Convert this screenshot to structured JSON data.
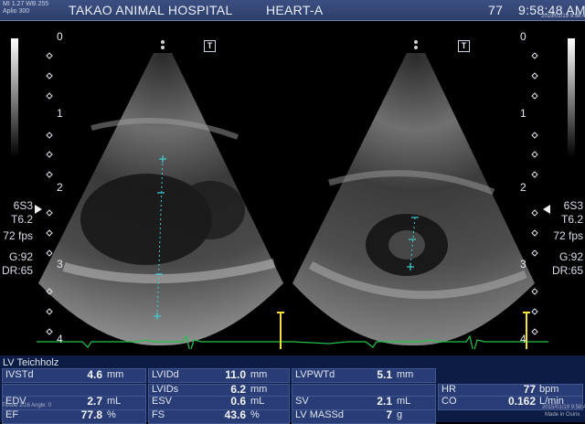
{
  "header": {
    "line1": "MI 1.27 WB 255",
    "line2": "Aplio 300",
    "hospital": "TAKAO ANIMAL HOSPITAL",
    "preset": "HEART-A",
    "frame": "77",
    "time": "9:58:48 AM",
    "date_top": "2015/01/19 9:58:48"
  },
  "depth_scale": [
    "0",
    "1",
    "2",
    "3",
    "4"
  ],
  "settings": {
    "probe": "6S3",
    "tgc": "T6.2",
    "fps": "72 fps",
    "gain": "G:92",
    "dr": "DR:65"
  },
  "markers": {
    "left": "T",
    "right": "T"
  },
  "footer_small": {
    "line1": "Tissue 2/16 Angle: 0",
    "line2": "2015/01/19 9:58:48",
    "line3": "Made in Osirix"
  },
  "report": {
    "title": "LV Teichholz",
    "rows": [
      [
        {
          "label": "IVSTd",
          "value": "4.6",
          "unit": "mm"
        },
        {
          "label": "LVIDd",
          "value": "11.0",
          "unit": "mm"
        },
        {
          "label": "LVPWTd",
          "value": "5.1",
          "unit": "mm"
        }
      ],
      [
        {
          "label": "",
          "value": "",
          "unit": ""
        },
        {
          "label": "LVIDs",
          "value": "6.2",
          "unit": "mm"
        },
        {
          "label": "",
          "value": "",
          "unit": ""
        },
        {
          "label": "HR",
          "value": "77",
          "unit": "bpm"
        }
      ],
      [
        {
          "label": "EDV",
          "value": "2.7",
          "unit": "mL"
        },
        {
          "label": "ESV",
          "value": "0.6",
          "unit": "mL"
        },
        {
          "label": "SV",
          "value": "2.1",
          "unit": "mL"
        },
        {
          "label": "CO",
          "value": "0.162",
          "unit": "L/min"
        }
      ],
      [
        {
          "label": "EF",
          "value": "77.8",
          "unit": "%"
        },
        {
          "label": "FS",
          "value": "43.6",
          "unit": "%"
        },
        {
          "label": "LV MASSd",
          "value": "7",
          "unit": "g"
        }
      ]
    ]
  }
}
